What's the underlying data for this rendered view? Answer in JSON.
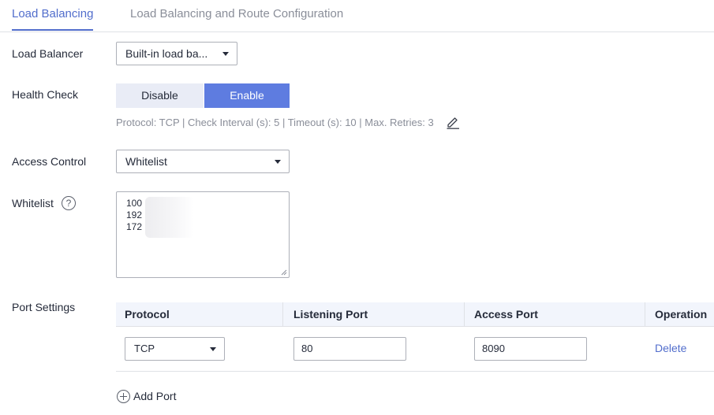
{
  "tabs": [
    {
      "label": "Load Balancing",
      "active": true
    },
    {
      "label": "Load Balancing and Route Configuration",
      "active": false
    }
  ],
  "load_balancer": {
    "label": "Load Balancer",
    "value": "Built-in load ba..."
  },
  "health_check": {
    "label": "Health Check",
    "options": [
      "Disable",
      "Enable"
    ],
    "selected": "Enable",
    "info": "Protocol: TCP | Check Interval (s): 5 | Timeout (s): 10 | Max. Retries: 3"
  },
  "access_control": {
    "label": "Access Control",
    "value": "Whitelist"
  },
  "whitelist": {
    "label": "Whitelist",
    "help": "?",
    "lines": [
      "100",
      "192",
      "172"
    ]
  },
  "port_settings": {
    "label": "Port Settings",
    "columns": [
      "Protocol",
      "Listening Port",
      "Access Port",
      "Operation"
    ],
    "rows": [
      {
        "protocol": "TCP",
        "listening_port": "80",
        "access_port": "8090",
        "operation": "Delete"
      }
    ],
    "add_label": "Add Port"
  },
  "colors": {
    "accent": "#526ecc",
    "toggle_active": "#5e7ce0",
    "toggle_inactive": "#e9ecf6"
  },
  "icons": [
    "edit-icon",
    "help-icon",
    "chevron-down-icon",
    "add-circle-icon"
  ]
}
